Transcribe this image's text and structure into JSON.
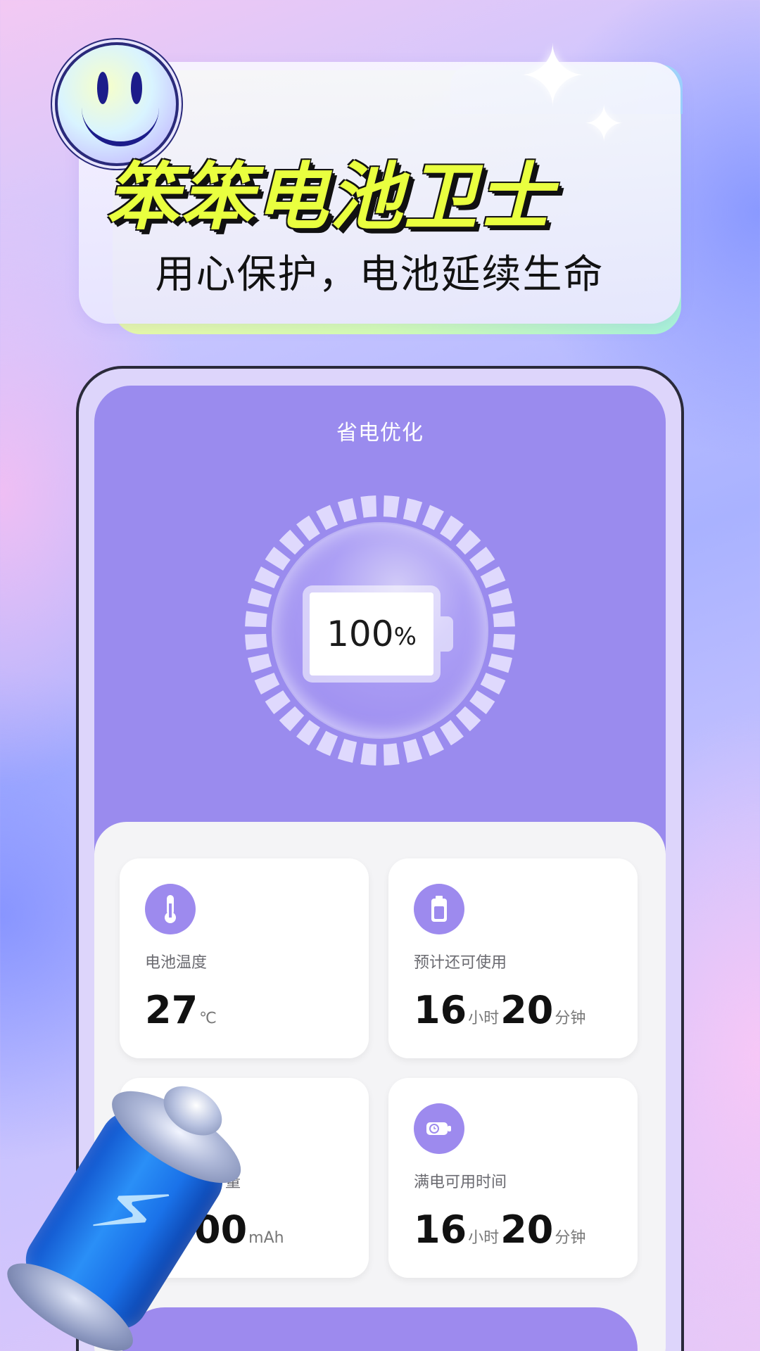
{
  "header": {
    "title": "笨笨电池卫士",
    "subtitle": "用心保护，电池延续生命"
  },
  "screen": {
    "title": "省电优化",
    "battery": {
      "level_number": "100",
      "level_unit": "%",
      "level_fraction": 1.0
    }
  },
  "stats": {
    "temperature": {
      "label": "电池温度",
      "value": "27",
      "unit": "℃",
      "icon": "thermometer-icon"
    },
    "remaining": {
      "label": "预计还可使用",
      "hours": "16",
      "hours_unit": "小时",
      "minutes": "20",
      "minutes_unit": "分钟",
      "icon": "battery-icon"
    },
    "capacity": {
      "label_visible": "量",
      "value_visible": "00",
      "unit": "mAh",
      "icon": "capacity-icon"
    },
    "full_charge": {
      "label": "满电可用时间",
      "hours": "16",
      "hours_unit": "小时",
      "minutes": "20",
      "minutes_unit": "分钟",
      "icon": "charging-time-icon"
    }
  },
  "colors": {
    "accent": "#9a8bee",
    "title_yellow": "#e9ff3f",
    "panel_bg": "#f4f4f6"
  }
}
